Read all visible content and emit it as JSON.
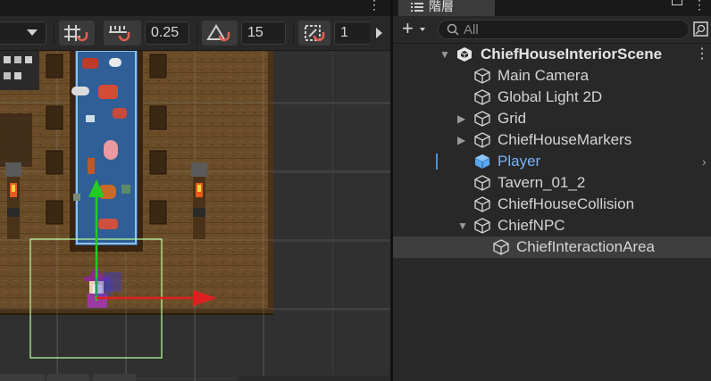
{
  "scene_toolbar": {
    "snap_increment": "0.25",
    "rotation_snap": "15",
    "scale_snap": "1"
  },
  "hierarchy": {
    "tab_label": "階層",
    "search_placeholder": "All",
    "scene_name": "ChiefHouseInteriorScene",
    "items": [
      {
        "label": "Main Camera",
        "icon": "gameobject-cube-icon"
      },
      {
        "label": "Global Light 2D",
        "icon": "gameobject-cube-icon"
      },
      {
        "label": "Grid",
        "icon": "gameobject-cube-icon",
        "collapsed": true
      },
      {
        "label": "ChiefHouseMarkers",
        "icon": "gameobject-cube-icon",
        "collapsed": true
      },
      {
        "label": "Player",
        "icon": "prefab-cube-icon",
        "prefab": true
      },
      {
        "label": "Tavern_01_2",
        "icon": "gameobject-cube-icon"
      },
      {
        "label": "ChiefHouseCollision",
        "icon": "gameobject-cube-icon"
      },
      {
        "label": "ChiefNPC",
        "icon": "gameobject-cube-icon",
        "expanded": true
      },
      {
        "label": "ChiefInteractionArea",
        "icon": "gameobject-cube-icon",
        "selected": true
      }
    ]
  },
  "colors": {
    "prefab_blue": "#7bb2f3",
    "move_x_axis": "#e02020",
    "move_y_axis": "#22cc22",
    "collider_outline": "#b6f59a"
  }
}
